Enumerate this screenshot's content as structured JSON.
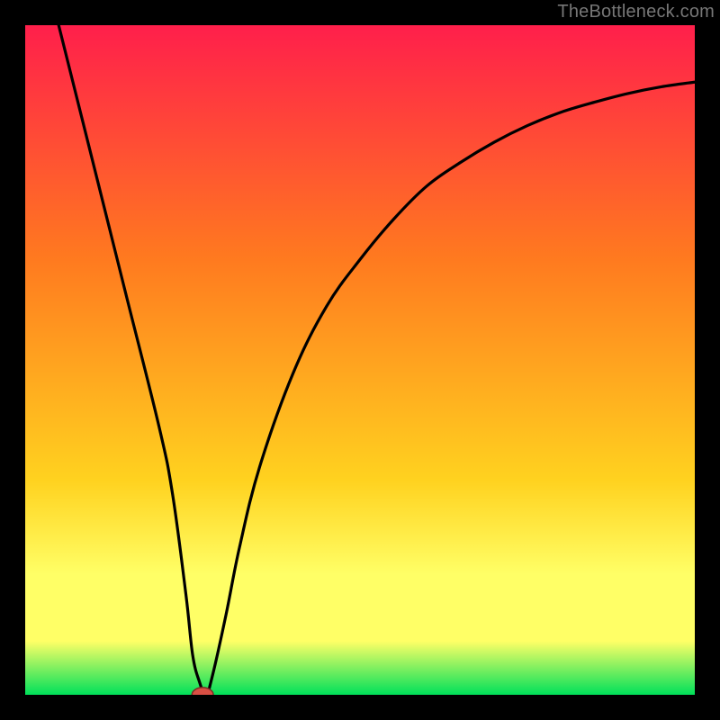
{
  "watermark": "TheBottleneck.com",
  "colors": {
    "frame": "#000000",
    "curve": "#000000",
    "marker_fill": "#d94f44",
    "marker_stroke": "#7a2b24",
    "gradient_top": "#ff1f4b",
    "gradient_mid1": "#ff7a1f",
    "gradient_mid2": "#ffd21f",
    "gradient_band": "#ffff66",
    "gradient_bottom": "#00e05a"
  },
  "chart_data": {
    "type": "line",
    "title": "",
    "xlabel": "",
    "ylabel": "",
    "xlim": [
      0,
      100
    ],
    "ylim": [
      0,
      100
    ],
    "x": [
      5,
      10,
      15,
      20,
      22,
      24,
      25,
      26,
      27,
      28,
      30,
      32,
      35,
      40,
      45,
      50,
      55,
      60,
      65,
      70,
      75,
      80,
      85,
      90,
      95,
      100
    ],
    "values": [
      100,
      80,
      60,
      40,
      30,
      15,
      6,
      2,
      0,
      3,
      12,
      22,
      34,
      48,
      58,
      65,
      71,
      76,
      79.5,
      82.5,
      85,
      87,
      88.5,
      89.8,
      90.8,
      91.5
    ],
    "marker": {
      "x": 26.5,
      "y": 0,
      "rx": 1.6,
      "ry": 1.1
    }
  }
}
